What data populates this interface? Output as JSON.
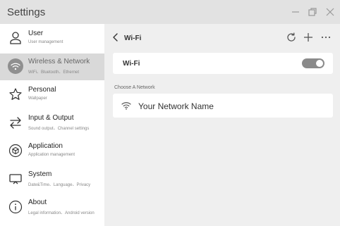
{
  "window": {
    "title": "Settings",
    "controls": [
      "minimize",
      "restore",
      "close"
    ]
  },
  "sidebar": {
    "items": [
      {
        "label": "User",
        "sub": "User management",
        "icon": "user-icon",
        "active": false
      },
      {
        "label": "Wireless & Network",
        "sub": "WiFi、Bluetooth、Ethernet",
        "icon": "wifi-icon",
        "active": true
      },
      {
        "label": "Personal",
        "sub": "Wallpaper",
        "icon": "star-icon",
        "active": false
      },
      {
        "label": "Input & Output",
        "sub": "Sound output、Channel settings",
        "icon": "swap-arrows-icon",
        "active": false
      },
      {
        "label": "Application",
        "sub": "Application management",
        "icon": "cube-icon",
        "active": false
      },
      {
        "label": "System",
        "sub": "Date&Time、Language、Privacy",
        "icon": "monitor-icon",
        "active": false
      },
      {
        "label": "About",
        "sub": "Legal information、Android version",
        "icon": "info-icon",
        "active": false
      }
    ]
  },
  "main": {
    "page_title": "Wi-Fi",
    "toolbar": [
      "refresh-icon",
      "add-icon",
      "more-icon"
    ],
    "wifi_toggle": {
      "label": "Wi-Fi",
      "on": true
    },
    "section_label": "Choose A Network",
    "networks": [
      {
        "name": "Your Network Name",
        "icon": "wifi-signal-icon"
      }
    ]
  },
  "colors": {
    "titlebar": "#e2e2e2",
    "sidebar": "#ffffff",
    "active_item": "#d9d9d9",
    "content_bg": "#efefef",
    "toggle_on": "#8a8a8a"
  }
}
